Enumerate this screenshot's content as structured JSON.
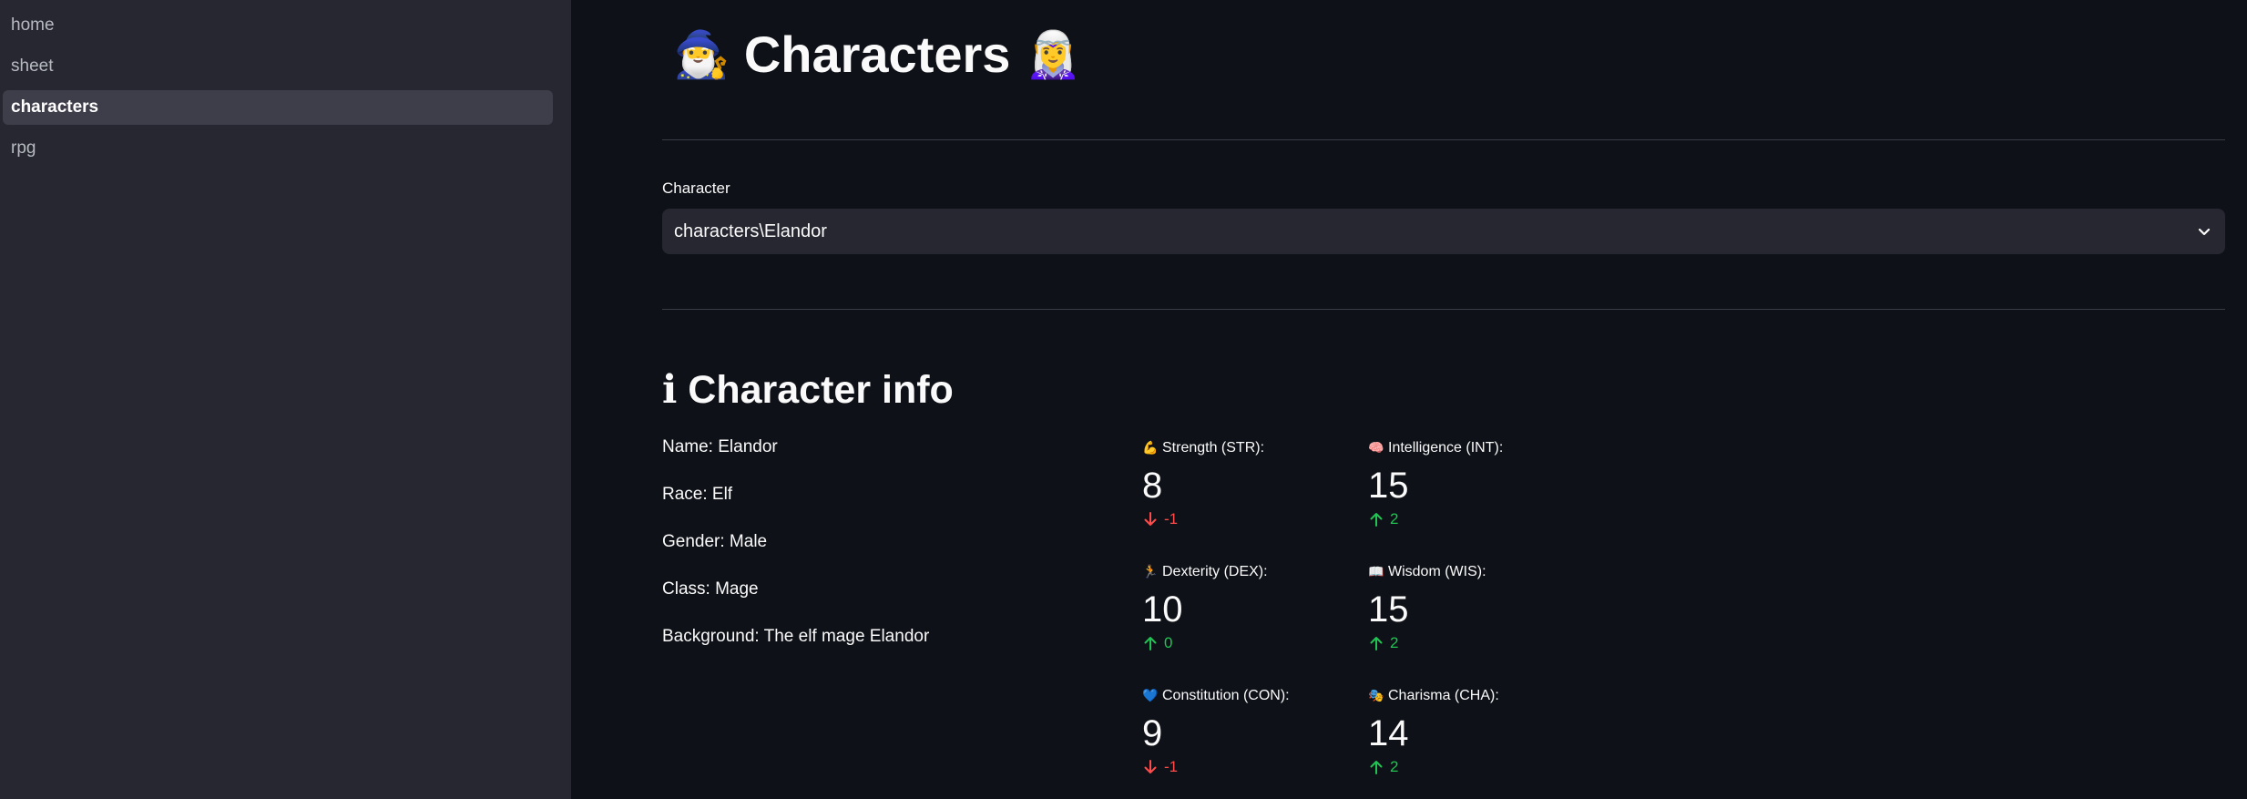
{
  "sidebar": {
    "items": [
      {
        "label": "home"
      },
      {
        "label": "sheet"
      },
      {
        "label": "characters"
      },
      {
        "label": "rpg"
      }
    ]
  },
  "header": {
    "emoji_left": "🧙‍♂️",
    "title": "Characters",
    "emoji_right": "🧝‍♀️"
  },
  "select": {
    "label": "Character",
    "value": "characters\\Elandor"
  },
  "info": {
    "section_icon": "ℹ",
    "section_title": "Character info",
    "lines": [
      "Name: Elandor",
      "Race: Elf",
      "Gender: Male",
      "Class: Mage",
      "Background: The elf mage Elandor"
    ]
  },
  "colors": {
    "delta_up": "#21c354",
    "delta_down": "#ff4b4b",
    "background": "#0e1117",
    "sidebar": "#262730"
  },
  "stats": [
    {
      "icon": "💪",
      "icon_name": "flexed-biceps-icon",
      "label": "Strength (STR):",
      "value": "8",
      "delta": "-1",
      "direction": "down"
    },
    {
      "icon": "🧠",
      "icon_name": "brain-icon",
      "label": "Intelligence (INT):",
      "value": "15",
      "delta": "2",
      "direction": "up"
    },
    {
      "icon": "🏃",
      "icon_name": "running-person-icon",
      "label": "Dexterity (DEX):",
      "value": "10",
      "delta": "0",
      "direction": "up"
    },
    {
      "icon": "📖",
      "icon_name": "open-book-icon",
      "label": "Wisdom (WIS):",
      "value": "15",
      "delta": "2",
      "direction": "up"
    },
    {
      "icon": "💙",
      "icon_name": "blue-heart-icon",
      "label": "Constitution (CON):",
      "value": "9",
      "delta": "-1",
      "direction": "down"
    },
    {
      "icon": "🎭",
      "icon_name": "performing-arts-icon",
      "label": "Charisma (CHA):",
      "value": "14",
      "delta": "2",
      "direction": "up"
    }
  ]
}
